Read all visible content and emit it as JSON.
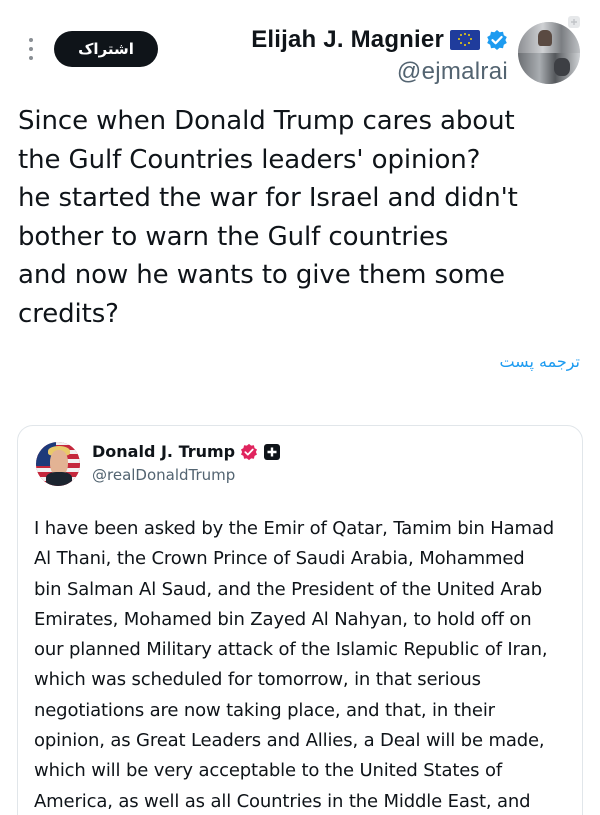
{
  "header": {
    "subscribe_label": "اشتراک",
    "author_name": "Elijah J. Magnier",
    "author_handle": "@ejmalrai",
    "flag_icon": "eu-flag-icon",
    "badge_icon": "verified-badge-icon",
    "badge_color": "#1d9bf0"
  },
  "tweet": {
    "text": "Since when Donald Trump cares about\nthe Gulf Countries leaders' opinion?\nhe started the war for Israel and didn't\nbother to warn the Gulf countries\nand now he wants to give them some\ncredits?",
    "translate_label": "ترجمه پست"
  },
  "quoted": {
    "name": "Donald J. Trump",
    "handle": "@realDonaldTrump",
    "badge_color": "#e0245e",
    "affiliate_icon": "government-affiliate-icon",
    "text": "I have been asked by the Emir of Qatar, Tamim bin Hamad\nAl Thani, the Crown Prince of Saudi Arabia, Mohammed\nbin Salman Al Saud, and the President of the United Arab\nEmirates, Mohamed bin Zayed Al Nahyan, to hold off on\nour planned Military attack of the Islamic Republic of Iran,\nwhich was scheduled for tomorrow, in that serious\nnegotiations are now taking place, and that, in their\nopinion, as Great Leaders and Allies, a Deal will be made,\nwhich will be very acceptable to the United States of\nAmerica, as well as all Countries in the Middle East, and"
  }
}
